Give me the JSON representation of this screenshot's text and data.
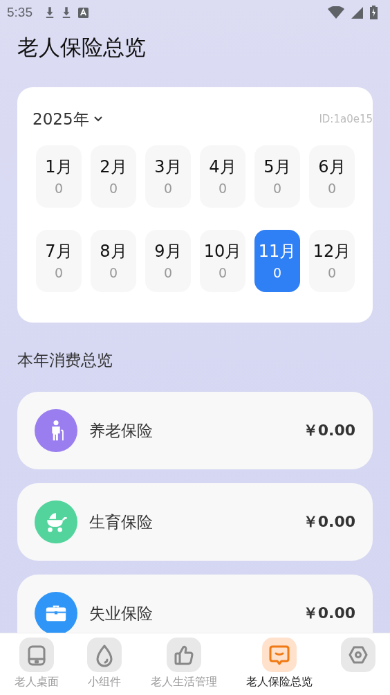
{
  "status_bar": {
    "time": "5:35"
  },
  "title": "老人保险总览",
  "calendar": {
    "year": "2025年",
    "id_text": "ID:1a0e15",
    "months": [
      {
        "label": "1月",
        "count": "0",
        "selected": false
      },
      {
        "label": "2月",
        "count": "0",
        "selected": false
      },
      {
        "label": "3月",
        "count": "0",
        "selected": false
      },
      {
        "label": "4月",
        "count": "0",
        "selected": false
      },
      {
        "label": "5月",
        "count": "0",
        "selected": false
      },
      {
        "label": "6月",
        "count": "0",
        "selected": false
      },
      {
        "label": "7月",
        "count": "0",
        "selected": false
      },
      {
        "label": "8月",
        "count": "0",
        "selected": false
      },
      {
        "label": "9月",
        "count": "0",
        "selected": false
      },
      {
        "label": "10月",
        "count": "0",
        "selected": false
      },
      {
        "label": "11月",
        "count": "0",
        "selected": true
      },
      {
        "label": "12月",
        "count": "0",
        "selected": false
      }
    ]
  },
  "section_title": "本年消费总览",
  "insurances": [
    {
      "kind": "pension",
      "name": "养老保险",
      "amount": "￥0.00",
      "color": "#9a7ef0"
    },
    {
      "kind": "maternity",
      "name": "生育保险",
      "amount": "￥0.00",
      "color": "#52d49c"
    },
    {
      "kind": "unemployment",
      "name": "失业保险",
      "amount": "￥0.00",
      "color": "#2f96f7"
    }
  ],
  "tabs": [
    {
      "kind": "phone",
      "label": "老人桌面",
      "selected": false
    },
    {
      "kind": "drop",
      "label": "小组件",
      "selected": false
    },
    {
      "kind": "thumb",
      "label": "老人生活管理",
      "selected": false
    },
    {
      "kind": "chat",
      "label": "老人保险总览",
      "selected": true
    },
    {
      "kind": "hex",
      "selected": false
    }
  ]
}
